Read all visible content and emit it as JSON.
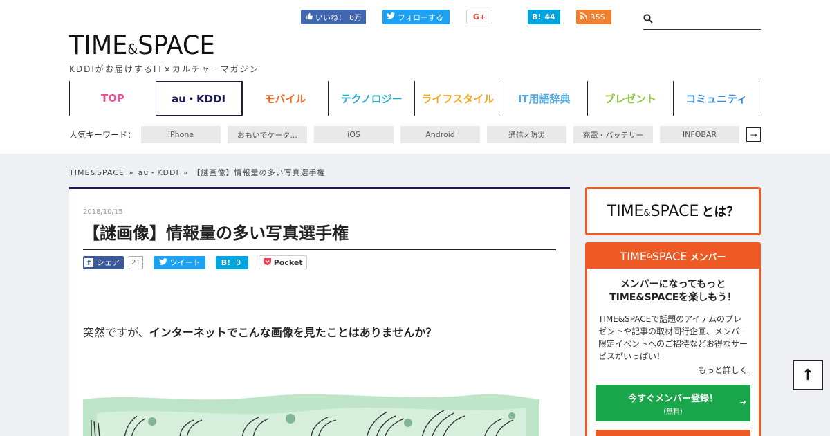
{
  "header": {
    "social": {
      "like_label": "いいね！",
      "like_count": "6万",
      "follow_label": "フォローする",
      "gplus_label": "G+",
      "hatena_label": "B!",
      "hatena_count": "44",
      "rss_label": "RSS"
    },
    "search": {
      "placeholder": ""
    },
    "logo": {
      "part1": "TIME",
      "amp": "&",
      "part2": "SPACE",
      "tagline": "KDDIがお届けするIT×カルチャーマガジン"
    },
    "nav": [
      {
        "label": "TOP",
        "color": "#e8529a"
      },
      {
        "label": "au・KDDI",
        "color": "#1b1c57"
      },
      {
        "label": "モバイル",
        "color": "#ee6a24"
      },
      {
        "label": "テクノロジー",
        "color": "#29a7c7"
      },
      {
        "label": "ライフスタイル",
        "color": "#f0a41b"
      },
      {
        "label": "IT用語辞典",
        "color": "#52a9e0"
      },
      {
        "label": "プレゼント",
        "color": "#8cc63f"
      },
      {
        "label": "コミュニティ",
        "color": "#3d8bd5"
      }
    ],
    "keywords": {
      "label": "人気キーワード：",
      "items": [
        "iPhone",
        "おもいでケータ...",
        "iOS",
        "Android",
        "通信×防災",
        "充電・バッテリー",
        "INFOBAR"
      ],
      "more_icon": "→"
    }
  },
  "breadcrumb": {
    "items": [
      "TIME&SPACE",
      "au・KDDI",
      "【謎画像】情報量の多い写真選手権"
    ],
    "separator": "»"
  },
  "article": {
    "date": "2018/10/15",
    "title": "【謎画像】情報量の多い写真選手権",
    "share": {
      "fb_label": "シェア",
      "fb_count": "21",
      "tweet_label": "ツイート",
      "hatena_label": "B!",
      "hatena_count": "0",
      "pocket_label": "Pocket"
    },
    "lead_plain": "突然ですが、",
    "lead_bold": "インターネットでこんな画像を見たことはありませんか？"
  },
  "sidebar": {
    "about": {
      "part1": "TIME",
      "amp": "&",
      "part2": "SPACE",
      "suffix": "とは？"
    },
    "member": {
      "head_part1": "TIME",
      "head_amp": "&",
      "head_part2": "SPACE",
      "head_suffix": "メンバー",
      "catch_line1": "メンバーになってもっと",
      "catch_line2": "TIME&SPACEを楽しもう！",
      "description": "TIME&SPACEで話題のアイテムのプレゼントや記事の取材同行企画、メンバー限定イベントへのご招待などお得なサービスがいっぱい！",
      "more_link": "もっと詳しく",
      "register_label": "今すぐメンバー登録！",
      "register_sub": "（無料）"
    }
  },
  "page_top_icon": "↑",
  "colors": {
    "brand_navy": "#1b1c57",
    "brand_orange": "#ee5a24",
    "register_green": "#1aa64a",
    "main_bg": "#eef0f3"
  }
}
